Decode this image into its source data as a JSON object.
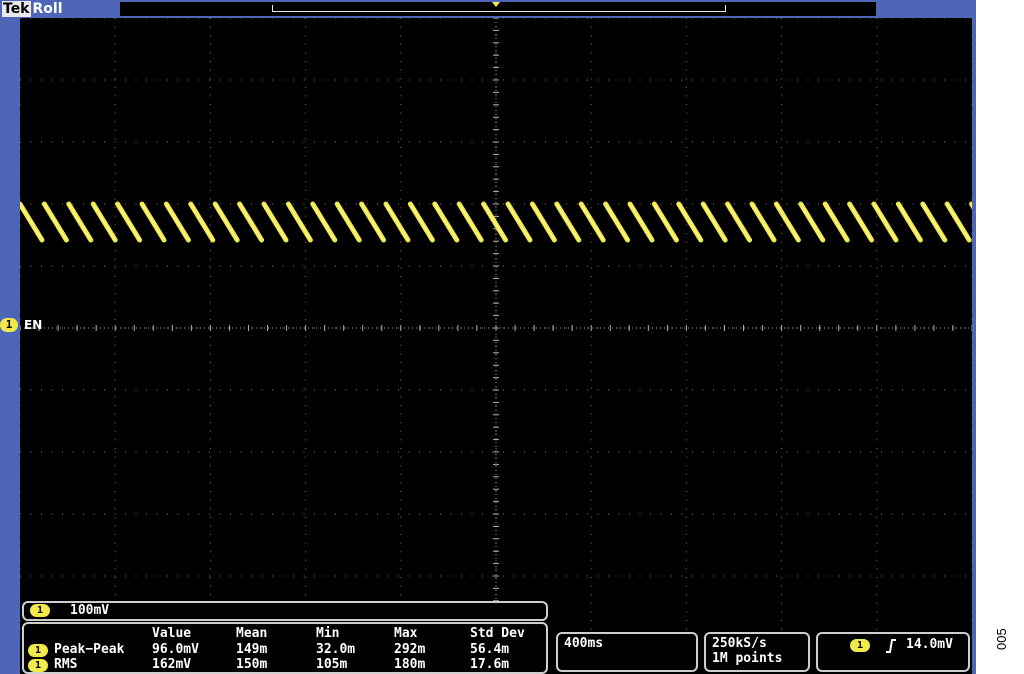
{
  "header": {
    "brand": "Tek",
    "mode": "Roll"
  },
  "channel": {
    "number": "1",
    "label": "EN",
    "scale": "100mV",
    "trace_color": "#f2e94a"
  },
  "measurements": {
    "columns": [
      "Value",
      "Mean",
      "Min",
      "Max",
      "Std Dev"
    ],
    "rows": [
      {
        "ch": "1",
        "name": "Peak−Peak",
        "values": [
          "96.0mV",
          "149m",
          "32.0m",
          "292m",
          "56.4m"
        ]
      },
      {
        "ch": "1",
        "name": "RMS",
        "values": [
          "162mV",
          "150m",
          "105m",
          "180m",
          "17.6m"
        ]
      }
    ]
  },
  "timebase": {
    "per_div": "400ms"
  },
  "acquisition": {
    "sample_rate": "250kS/s",
    "record_length": "1M points"
  },
  "trigger": {
    "ch": "1",
    "slope_icon": "rising-edge-icon",
    "level": "14.0mV"
  },
  "figure_number": "005",
  "colors": {
    "frame": "#4d66b8",
    "trace": "#f2e94a",
    "screen": "#000000"
  }
}
